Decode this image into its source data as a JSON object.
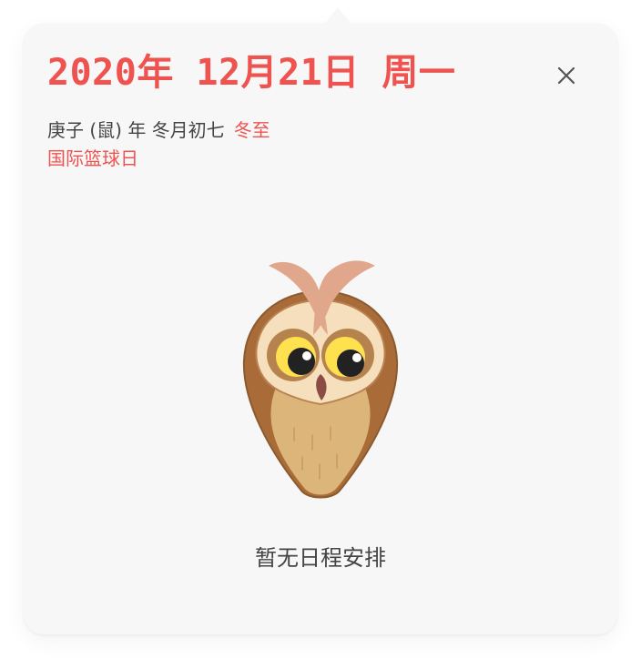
{
  "date_header": {
    "title": "2020年 12月21日 周一"
  },
  "lunar": {
    "date_text": "庚子 (鼠) 年 冬月初七",
    "solar_term": "冬至"
  },
  "festival": {
    "name": "国际篮球日"
  },
  "empty_state": {
    "message": "暂无日程安排",
    "illustration": "owl-illustration"
  },
  "icons": {
    "close": "close-icon"
  },
  "colors": {
    "accent": "#ef5350",
    "text_primary": "#444444",
    "panel_background": "#f7f7f7",
    "close_icon": "#555555"
  }
}
